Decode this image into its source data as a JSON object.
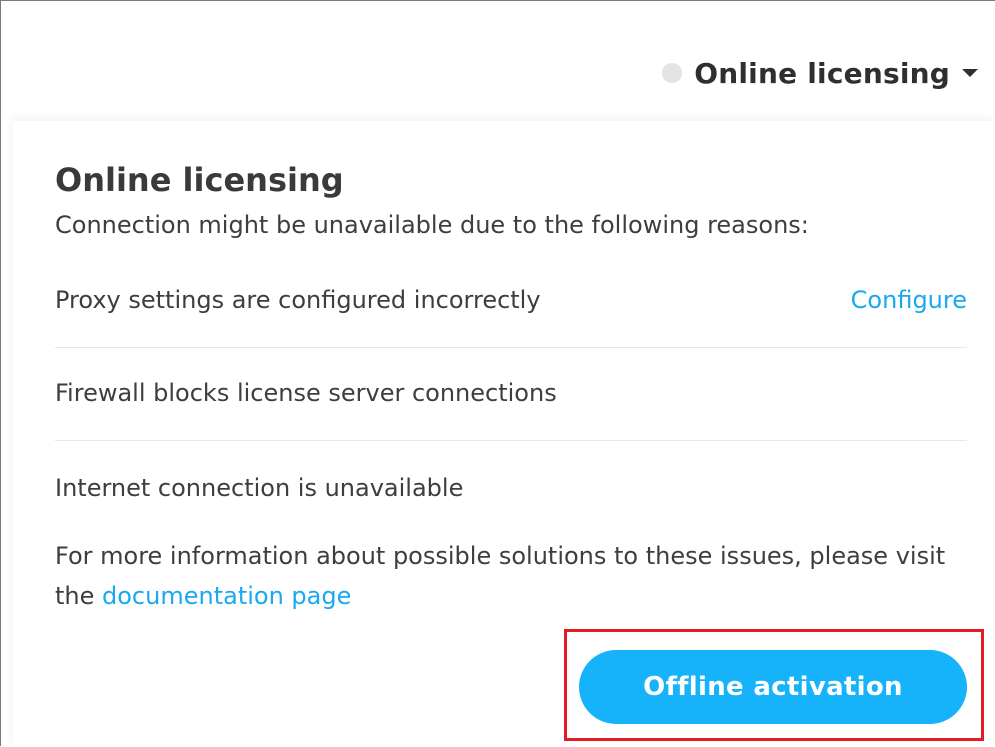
{
  "header": {
    "status_label": "Online licensing",
    "status_icon": "status-dot-icon",
    "dropdown_icon": "caret-down-icon"
  },
  "panel": {
    "title": "Online licensing",
    "subtitle": "Connection might be unavailable due to the following reasons:",
    "reasons": [
      {
        "text": "Proxy settings are configured incorrectly",
        "action_label": "Configure"
      },
      {
        "text": "Firewall blocks license server connections"
      },
      {
        "text": "Internet connection is unavailable"
      }
    ],
    "info_prefix": "For more information about possible solutions to these issues, please visit the ",
    "info_link": "documentation page",
    "offline_button_label": "Offline activation"
  },
  "colors": {
    "accent": "#16b3fb",
    "link": "#18a9ef",
    "highlight": "#e01b24",
    "text": "#3e3e3e"
  }
}
